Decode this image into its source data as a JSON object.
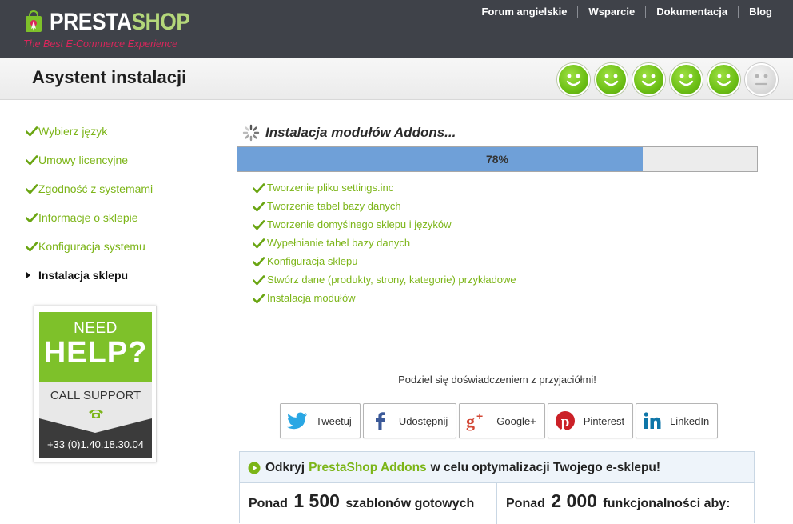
{
  "header": {
    "logo": {
      "brand_left": "PRESTA",
      "brand_right": "SHOP",
      "tagline": "The Best E-Commerce Experience"
    },
    "nav": [
      "Forum angielskie",
      "Wsparcie",
      "Dokumentacja",
      "Blog"
    ]
  },
  "titlebar": {
    "title": "Asystent instalacji",
    "steps_completed": 5,
    "steps_total": 6
  },
  "sidebar": {
    "steps": [
      {
        "label": "Wybierz język",
        "state": "done"
      },
      {
        "label": "Umowy licencyjne",
        "state": "done"
      },
      {
        "label": "Zgodność z systemami",
        "state": "done"
      },
      {
        "label": "Informacje o sklepie",
        "state": "done"
      },
      {
        "label": "Konfiguracja systemu",
        "state": "done"
      },
      {
        "label": "Instalacja sklepu",
        "state": "current"
      }
    ],
    "help": {
      "need": "NEED",
      "help": "HELP?",
      "call": "CALL SUPPORT",
      "phone": "+33 (0)1.40.18.30.04"
    }
  },
  "main": {
    "title": "Instalacja modułów Addons...",
    "progress": {
      "percent": 78,
      "label": "78%"
    },
    "tasks": [
      "Tworzenie pliku settings.inc",
      "Tworzenie tabel bazy danych",
      "Tworzenie domyślnego sklepu i języków",
      "Wypełnianie tabel bazy danych",
      "Konfiguracja sklepu",
      "Stwórz dane (produkty, strony, kategorie) przykładowe",
      "Instalacja modułów"
    ],
    "share_label": "Podziel się doświadczeniem z przyjaciółmi!",
    "share_buttons": [
      {
        "label": "Tweetuj",
        "icon": "twitter-icon"
      },
      {
        "label": "Udostępnij",
        "icon": "facebook-icon"
      },
      {
        "label": "Google+",
        "icon": "google-plus-icon"
      },
      {
        "label": "Pinterest",
        "icon": "pinterest-icon"
      },
      {
        "label": "LinkedIn",
        "icon": "linkedin-icon"
      }
    ],
    "addons": {
      "pre": "Odkryj",
      "highlight": "PrestaShop Addons",
      "post": "w celu optymalizacji Twojego e-sklepu!",
      "col1": {
        "pre": "Ponad",
        "num": "1 500",
        "post": "szablonów gotowych"
      },
      "col2": {
        "pre": "Ponad",
        "num": "2 000",
        "post": "funkcjonalności aby:"
      }
    }
  },
  "colors": {
    "header_bg": "#3f4249",
    "accent_green": "#7cb518",
    "progress_fill": "#6fa0d8",
    "tagline": "#d9265b"
  }
}
